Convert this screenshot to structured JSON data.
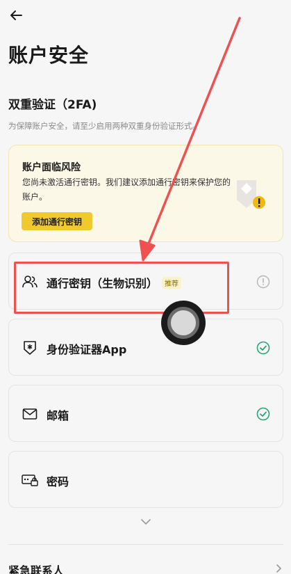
{
  "header": {
    "back_icon": "arrow-left-icon",
    "title": "账户安全"
  },
  "two_fa": {
    "title": "双重验证（2FA)",
    "description": "为保障账户安全，请至少启用两种双重身份验证形式。"
  },
  "warning": {
    "title": "账户面临风险",
    "text": "您尚未激活通行密钥。我们建议添加通行密钥来保护您的账户。",
    "button_label": "添加通行密钥",
    "colors": {
      "background": "#fcf8e7",
      "button": "#f0c92d",
      "alert": "#f0b90b"
    }
  },
  "methods": [
    {
      "label": "通行密钥（生物识别）",
      "badge": "推荐",
      "icon": "users-icon",
      "status": "not-enabled",
      "status_icon": "info-circle-icon"
    },
    {
      "label": "身份验证器App",
      "icon": "shield-star-icon",
      "status": "enabled",
      "status_icon": "check-circle-icon"
    },
    {
      "label": "邮箱",
      "icon": "mail-icon",
      "status": "enabled",
      "status_icon": "check-circle-icon"
    },
    {
      "label": "密码",
      "icon": "password-lock-icon",
      "status": "",
      "status_icon": ""
    }
  ],
  "more": {
    "icon": "chevron-down-icon"
  },
  "emergency": {
    "label": "紧急联系人",
    "icon": "chevron-right-icon"
  },
  "annotation": {
    "color": "#ee5150"
  },
  "status_colors": {
    "enabled": "#2aa673",
    "neutral": "#b5b5b5"
  }
}
